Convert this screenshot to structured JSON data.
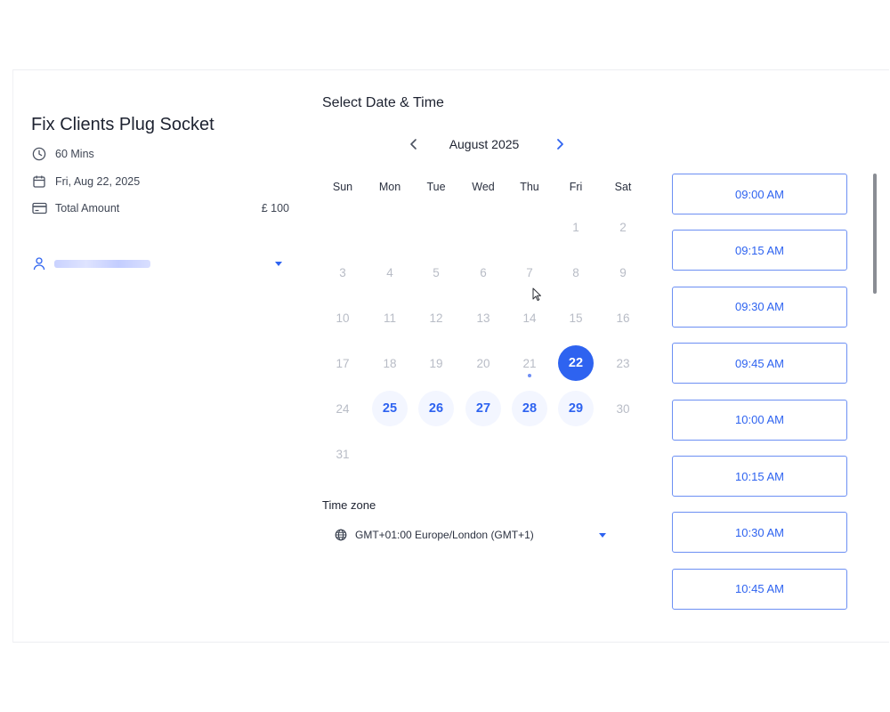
{
  "service": {
    "title": "Fix Clients Plug Socket",
    "duration": "60 Mins",
    "date": "Fri, Aug 22, 2025",
    "amount_label": "Total Amount",
    "amount_value": "£ 100"
  },
  "calendar": {
    "section_title": "Select Date & Time",
    "month_label": "August 2025",
    "weekdays": [
      "Sun",
      "Mon",
      "Tue",
      "Wed",
      "Thu",
      "Fri",
      "Sat"
    ],
    "days": [
      {
        "n": "1",
        "state": "disabled"
      },
      {
        "n": "2",
        "state": "disabled"
      },
      {
        "n": "3",
        "state": "disabled"
      },
      {
        "n": "4",
        "state": "disabled"
      },
      {
        "n": "5",
        "state": "disabled"
      },
      {
        "n": "6",
        "state": "disabled"
      },
      {
        "n": "7",
        "state": "disabled"
      },
      {
        "n": "8",
        "state": "disabled"
      },
      {
        "n": "9",
        "state": "disabled"
      },
      {
        "n": "10",
        "state": "disabled"
      },
      {
        "n": "11",
        "state": "disabled"
      },
      {
        "n": "12",
        "state": "disabled"
      },
      {
        "n": "13",
        "state": "disabled"
      },
      {
        "n": "14",
        "state": "disabled"
      },
      {
        "n": "15",
        "state": "disabled"
      },
      {
        "n": "16",
        "state": "disabled"
      },
      {
        "n": "17",
        "state": "disabled"
      },
      {
        "n": "18",
        "state": "disabled"
      },
      {
        "n": "19",
        "state": "disabled"
      },
      {
        "n": "20",
        "state": "disabled"
      },
      {
        "n": "21",
        "state": "today"
      },
      {
        "n": "22",
        "state": "selected"
      },
      {
        "n": "23",
        "state": "disabled"
      },
      {
        "n": "24",
        "state": "disabled"
      },
      {
        "n": "25",
        "state": "available"
      },
      {
        "n": "26",
        "state": "available"
      },
      {
        "n": "27",
        "state": "available"
      },
      {
        "n": "28",
        "state": "available"
      },
      {
        "n": "29",
        "state": "available"
      },
      {
        "n": "30",
        "state": "disabled"
      },
      {
        "n": "31",
        "state": "disabled"
      }
    ]
  },
  "timezone": {
    "label": "Time zone",
    "value": "GMT+01:00 Europe/London (GMT+1)"
  },
  "time_slots": [
    "09:00 AM",
    "09:15 AM",
    "09:30 AM",
    "09:45 AM",
    "10:00 AM",
    "10:15 AM",
    "10:30 AM",
    "10:45 AM"
  ],
  "colors": {
    "accent": "#2e63f0",
    "disabled_text": "#b8bcc6",
    "slot_border": "#6c8ff3"
  },
  "icons": {
    "duration": "clock-icon",
    "date": "calendar-icon",
    "amount": "credit-card-icon",
    "staff": "user-icon",
    "timezone": "globe-icon",
    "prev": "chevron-left-icon",
    "next": "chevron-right-icon"
  }
}
